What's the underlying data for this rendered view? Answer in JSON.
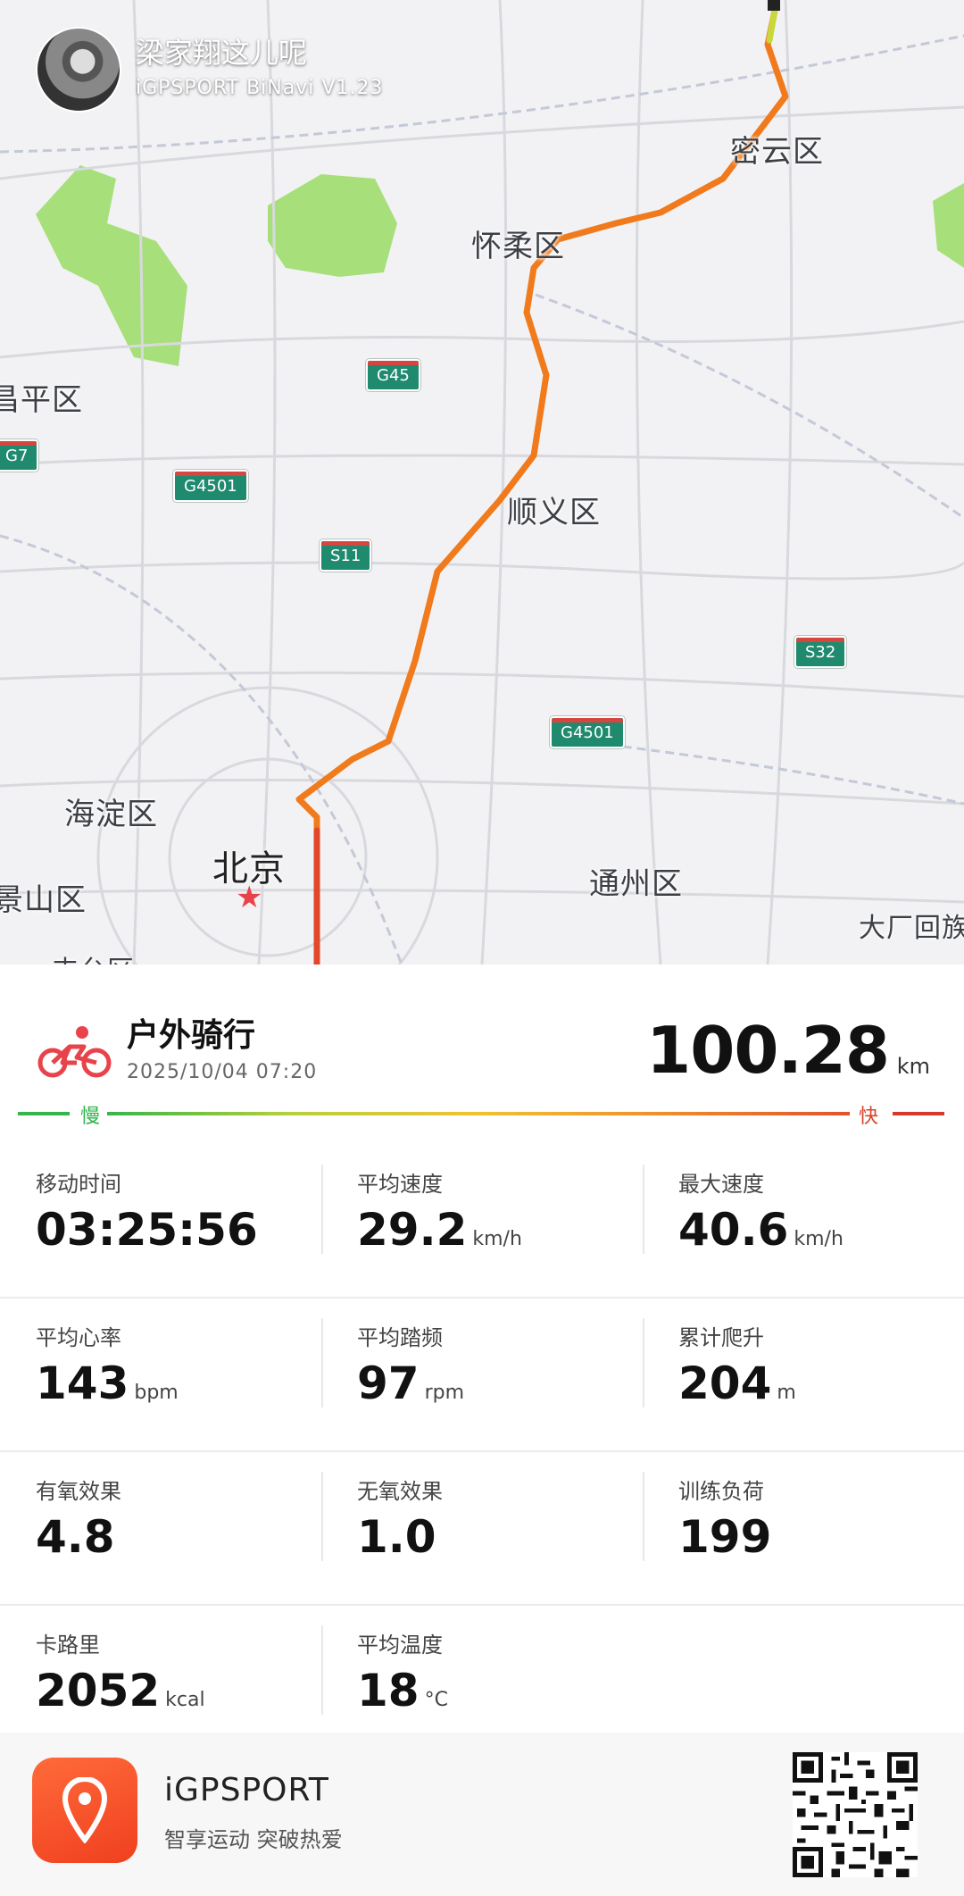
{
  "header": {
    "user_name": "梁家翔这儿呢",
    "device": "iGPSPORT BiNavi V1.23"
  },
  "map": {
    "labels": {
      "miyun": "密云区",
      "huairou": "怀柔区",
      "changping": "昌平区",
      "shunyi": "顺义区",
      "haidian": "海淀区",
      "beijing": "北京",
      "jingshan": "景山区",
      "tongzhou": "通州区",
      "dachang": "大厂回族",
      "fengtai": "丰台区"
    },
    "shields": {
      "g45": "G45",
      "g7": "G7",
      "g4501_a": "G4501",
      "s11": "S11",
      "s32": "S32",
      "g4501_b": "G4501"
    }
  },
  "activity": {
    "title": "户外骑行",
    "date": "2025/10/04 07:20",
    "distance": "100.28",
    "distance_unit": "km",
    "slow_label": "慢",
    "fast_label": "快"
  },
  "stats": [
    {
      "label": "移动时间",
      "value": "03:25:56",
      "unit": ""
    },
    {
      "label": "平均速度",
      "value": "29.2",
      "unit": "km/h"
    },
    {
      "label": "最大速度",
      "value": "40.6",
      "unit": "km/h"
    },
    {
      "label": "平均心率",
      "value": "143",
      "unit": "bpm"
    },
    {
      "label": "平均踏频",
      "value": "97",
      "unit": "rpm"
    },
    {
      "label": "累计爬升",
      "value": "204",
      "unit": "m"
    },
    {
      "label": "有氧效果",
      "value": "4.8",
      "unit": ""
    },
    {
      "label": "无氧效果",
      "value": "1.0",
      "unit": ""
    },
    {
      "label": "训练负荷",
      "value": "199",
      "unit": ""
    },
    {
      "label": "卡路里",
      "value": "2052",
      "unit": "kcal"
    },
    {
      "label": "平均温度",
      "value": "18",
      "unit": "°C"
    }
  ],
  "footer": {
    "app_name": "iGPSPORT",
    "slogan": "智享运动 突破热爱"
  },
  "colors": {
    "accent": "#e8434a",
    "route": "#f0701e",
    "park": "#a7e07a",
    "shield": "#1f8a6e"
  }
}
